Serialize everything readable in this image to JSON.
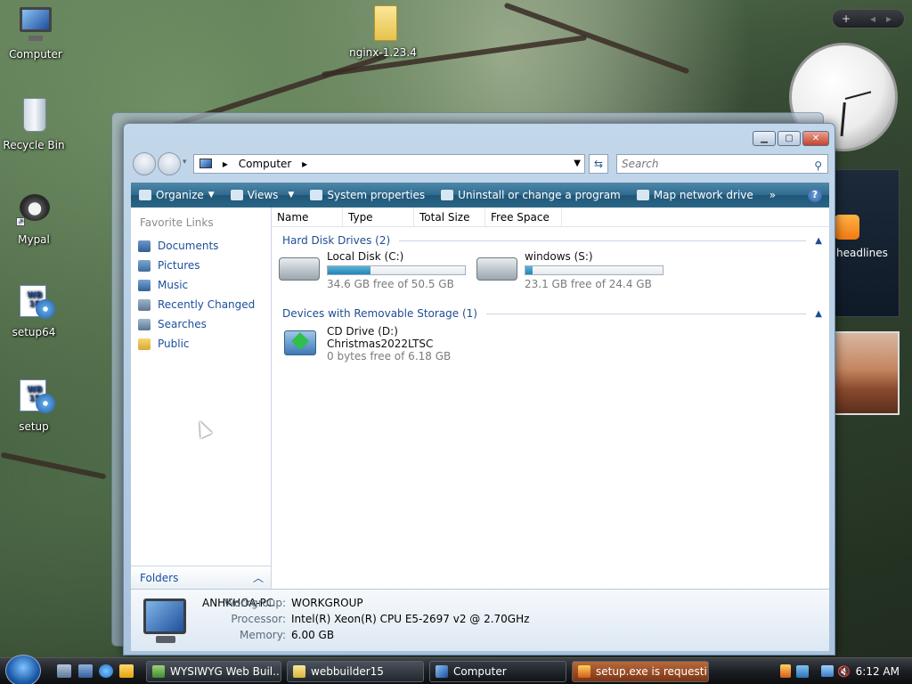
{
  "desktop": {
    "icons": [
      {
        "label": "Computer"
      },
      {
        "label": "Recycle Bin"
      },
      {
        "label": "Mypal"
      },
      {
        "label": "setup64"
      },
      {
        "label": "setup"
      },
      {
        "label": "nginx-1.23.4"
      }
    ],
    "setup64_badge": "WB\n18",
    "setup_badge": "WB\n15"
  },
  "sidebar": {
    "add_label": "+",
    "headlines_label": "headlines"
  },
  "window": {
    "address": {
      "path": "Computer",
      "separator": "▸"
    },
    "search_placeholder": "Search",
    "toolbar": {
      "organize": "Organize",
      "views": "Views",
      "system_properties": "System properties",
      "uninstall": "Uninstall or change a program",
      "map_drive": "Map network drive",
      "more": "»"
    },
    "nav": {
      "heading": "Favorite Links",
      "links": [
        "Documents",
        "Pictures",
        "Music",
        "Recently Changed",
        "Searches",
        "Public"
      ],
      "folders_label": "Folders"
    },
    "columns": [
      "Name",
      "Type",
      "Total Size",
      "Free Space"
    ],
    "groups": {
      "hdd": "Hard Disk Drives (2)",
      "removable": "Devices with Removable Storage (1)"
    },
    "drives": [
      {
        "name": "Local Disk (C:)",
        "free": "34.6 GB free of 50.5 GB",
        "used_fraction": 0.31
      },
      {
        "name": "windows (S:)",
        "free": "23.1 GB free of 24.4 GB",
        "used_fraction": 0.05
      }
    ],
    "cd": {
      "name": "CD Drive (D:)",
      "label": "Christmas2022LTSC",
      "free": "0 bytes free of 6.18 GB"
    },
    "details": {
      "computer_name": "ANHKHOA-PC",
      "workgroup_label": "Workgroup:",
      "workgroup": "WORKGROUP",
      "processor_label": "Processor:",
      "processor": "Intel(R) Xeon(R) CPU E5-2697 v2 @ 2.70GHz",
      "memory_label": "Memory:",
      "memory": "6.00 GB"
    }
  },
  "taskbar": {
    "tasks": [
      {
        "label": "WYSIWYG Web Buil..."
      },
      {
        "label": "webbuilder15"
      },
      {
        "label": "Computer"
      },
      {
        "label": "setup.exe is requesti..."
      }
    ],
    "clock": "6:12 AM"
  },
  "colors": {
    "toolbar": "#2f6a8f",
    "link": "#1b4f9c",
    "drive_fill": "#1f86b5"
  }
}
